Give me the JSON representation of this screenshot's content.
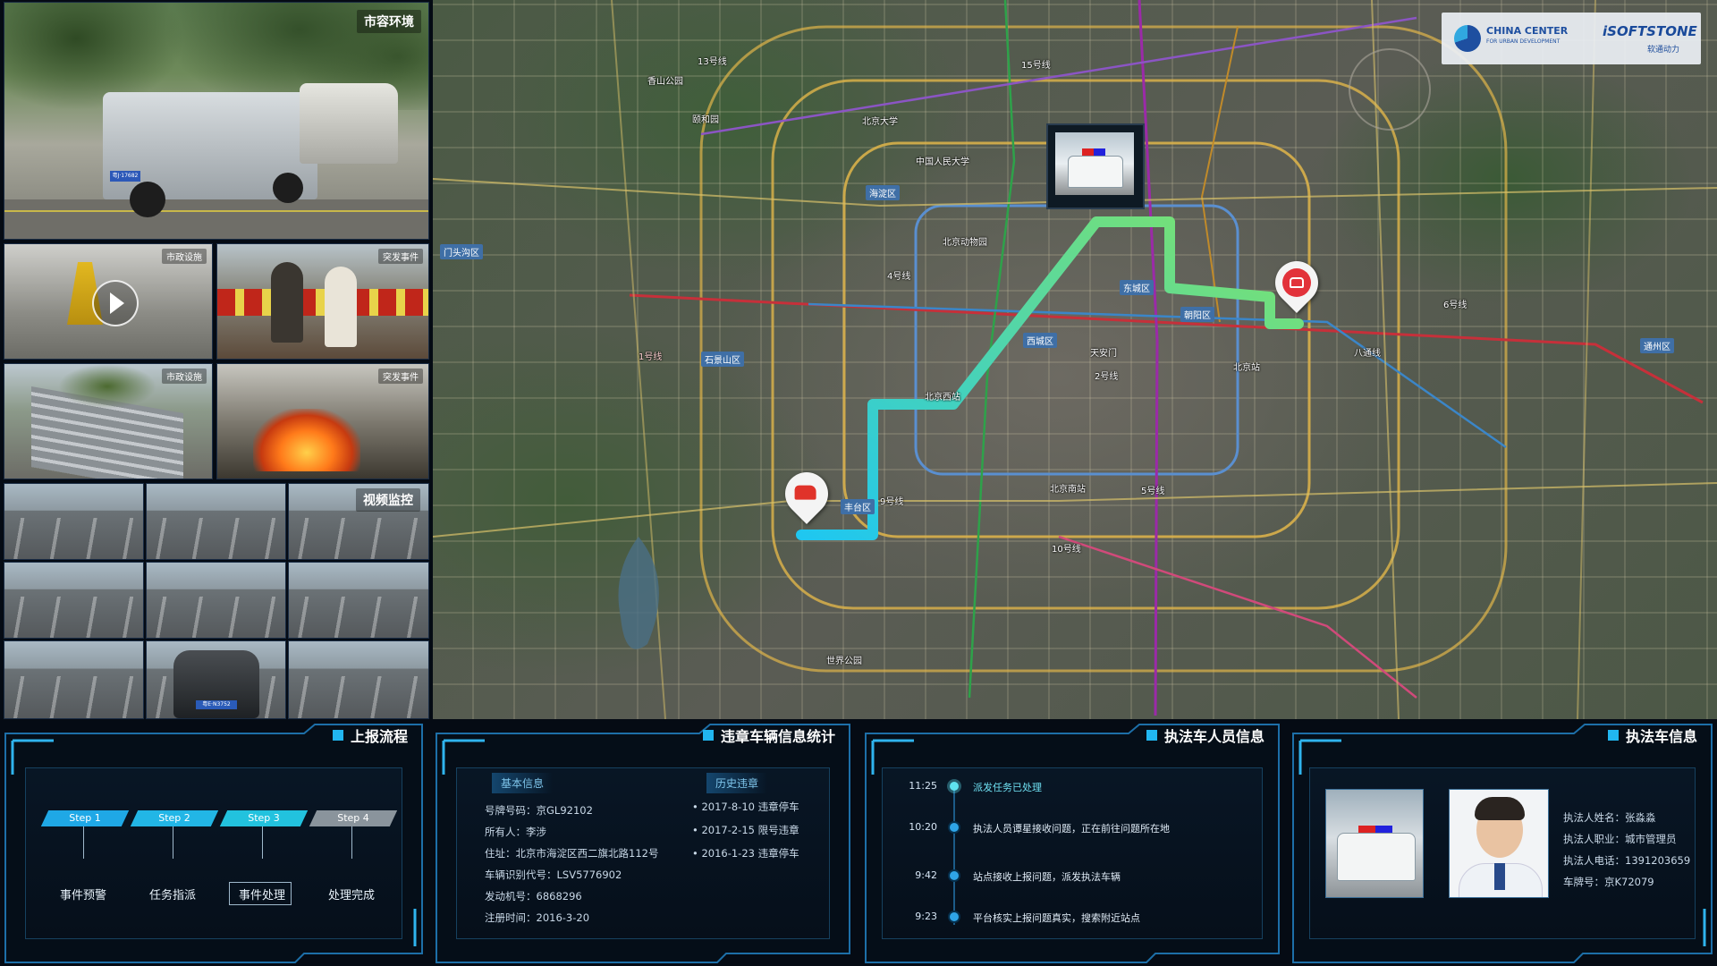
{
  "left_panel": {
    "top_tag": "市容环境",
    "tile_tags": [
      "市政设施",
      "突发事件",
      "市政设施",
      "突发事件"
    ],
    "video_tag": "视频监控",
    "plate_1": "粤J·17682",
    "plate_2": "粤E·N3752"
  },
  "map": {
    "logo": {
      "line1": "CHINA CENTER",
      "line2": "FOR URBAN DEVELOPMENT",
      "brand": "iSOFTSTONE",
      "brand_sub": "软通动力"
    },
    "districts": [
      "海淀区",
      "东城区",
      "朝阳区",
      "西城区",
      "石景山区",
      "丰台区",
      "门头沟区",
      "通州区"
    ],
    "places": [
      "北京大学",
      "中国人民大学",
      "北京站",
      "北京南站",
      "天安门",
      "北京西站",
      "香山公园",
      "颐和园",
      "北京动物园",
      "世界公园"
    ],
    "lines": [
      "1号线",
      "2号线",
      "4号线",
      "5号线",
      "10号线",
      "13号线",
      "15号线",
      "6号线",
      "八通线",
      "9号线"
    ],
    "marker_color_start": "#1fc7f0",
    "marker_color_end": "#7fe36a"
  },
  "flow_panel": {
    "title": "上报流程",
    "steps": [
      {
        "label": "Step 1",
        "name": "事件预警",
        "color": "#1fa8e6"
      },
      {
        "label": "Step 2",
        "name": "任务指派",
        "color": "#22b6e6"
      },
      {
        "label": "Step 3",
        "name": "事件处理",
        "color": "#22c2de"
      },
      {
        "label": "Step 4",
        "name": "处理完成",
        "color": "#8a949c"
      }
    ]
  },
  "vehicle_panel": {
    "title": "违章车辆信息统计",
    "basic_title": "基本信息",
    "history_title": "历史违章",
    "basic": [
      "号牌号码：京GL92102",
      "所有人：李涉",
      "住址：北京市海淀区西二旗北路112号",
      "车辆识别代号：LSV5776902",
      "发动机号：6868296",
      "注册时间：2016-3-20"
    ],
    "history": [
      "2017-8-10 违章停车",
      "2017-2-15 限号违章",
      "2016-1-23 违章停车"
    ]
  },
  "officer_panel": {
    "title": "执法车人员信息",
    "timeline": [
      {
        "time": "11:25",
        "text": "派发任务已处理"
      },
      {
        "time": "10:20",
        "text": "执法人员谭星接收问题，正在前往问题所在地"
      },
      {
        "time": "9:42",
        "text": "站点接收上报问题，派发执法车辆"
      },
      {
        "time": "9:23",
        "text": "平台核实上报问题真实，搜索附近站点"
      }
    ]
  },
  "enforce_panel": {
    "title": "执法车信息",
    "info": [
      "执法人姓名：张淼淼",
      "执法人职业：城市管理员",
      "执法人电话：1391203659",
      "车牌号：京K72079"
    ]
  }
}
